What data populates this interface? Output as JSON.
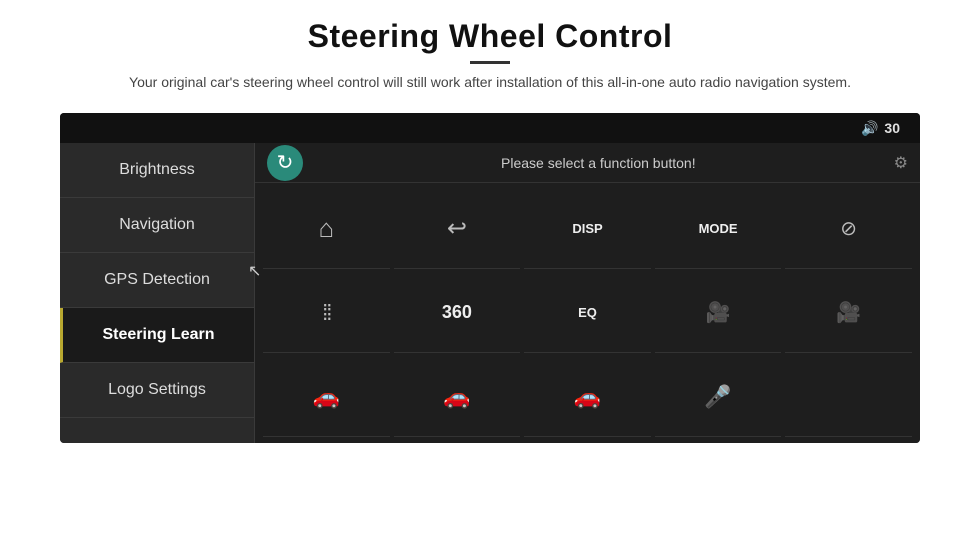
{
  "page": {
    "title": "Steering Wheel Control",
    "subtitle": "Your original car's steering wheel control will still work after installation of this all-in-one auto radio navigation system.",
    "divider": "—"
  },
  "device": {
    "volume_icon": "🔊",
    "volume_value": "30",
    "sidebar": {
      "items": [
        {
          "id": "brightness",
          "label": "Brightness",
          "active": false
        },
        {
          "id": "navigation",
          "label": "Navigation",
          "active": false
        },
        {
          "id": "gps-detection",
          "label": "GPS Detection",
          "active": false
        },
        {
          "id": "steering-learn",
          "label": "Steering Learn",
          "active": true
        },
        {
          "id": "logo-settings",
          "label": "Logo Settings",
          "active": false
        }
      ]
    },
    "main": {
      "sync_icon": "↻",
      "prompt": "Please select a function button!",
      "grid": [
        {
          "row": 1,
          "col": 1,
          "type": "icon",
          "content": "⌂",
          "label": ""
        },
        {
          "row": 1,
          "col": 2,
          "type": "icon",
          "content": "↩",
          "label": ""
        },
        {
          "row": 1,
          "col": 3,
          "type": "text",
          "content": "DISP",
          "label": ""
        },
        {
          "row": 1,
          "col": 4,
          "type": "text",
          "content": "MODE",
          "label": ""
        },
        {
          "row": 1,
          "col": 5,
          "type": "icon",
          "content": "🚫📞",
          "label": ""
        },
        {
          "row": 2,
          "col": 1,
          "type": "icon",
          "content": "⚙",
          "label": ""
        },
        {
          "row": 2,
          "col": 2,
          "type": "text",
          "content": "360",
          "label": ""
        },
        {
          "row": 2,
          "col": 3,
          "type": "text",
          "content": "EQ",
          "label": ""
        },
        {
          "row": 2,
          "col": 4,
          "type": "icon",
          "content": "📷",
          "label": ""
        },
        {
          "row": 2,
          "col": 5,
          "type": "icon",
          "content": "📷",
          "label": ""
        },
        {
          "row": 3,
          "col": 1,
          "type": "icon",
          "content": "🚗",
          "label": ""
        },
        {
          "row": 3,
          "col": 2,
          "type": "icon",
          "content": "🚗",
          "label": ""
        },
        {
          "row": 3,
          "col": 3,
          "type": "icon",
          "content": "🚗",
          "label": ""
        },
        {
          "row": 3,
          "col": 4,
          "type": "icon",
          "content": "🎤",
          "label": ""
        },
        {
          "row": 3,
          "col": 5,
          "type": "empty",
          "content": "",
          "label": ""
        }
      ]
    }
  }
}
